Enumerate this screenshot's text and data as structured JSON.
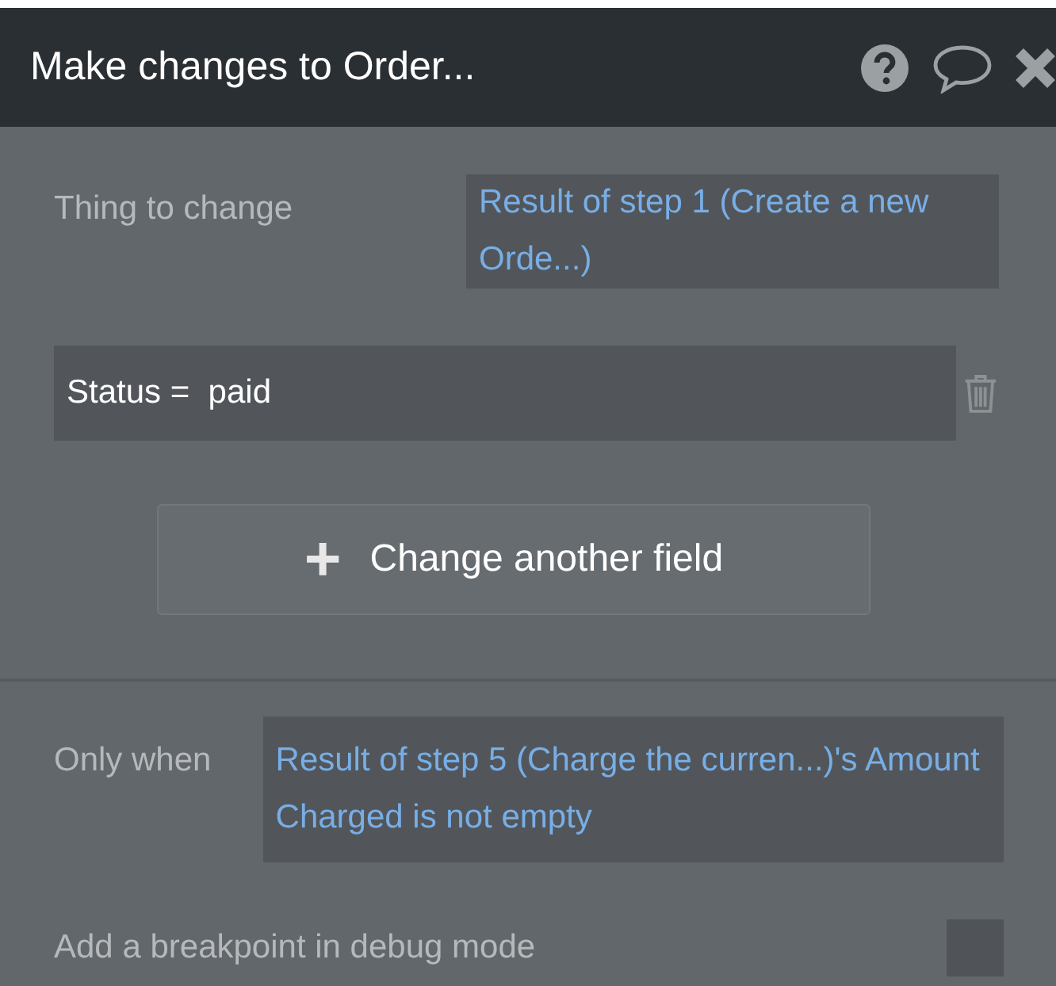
{
  "window": {
    "title": "Make changes to Order..."
  },
  "thing_to_change": {
    "label": "Thing to change",
    "value": "Result of step 1 (Create a new Orde...)"
  },
  "fields": [
    {
      "text": "Status =  paid"
    }
  ],
  "add_field_button": {
    "icon": "+",
    "label": "Change another field"
  },
  "only_when": {
    "label": "Only when",
    "value": "Result of step 5 (Charge the curren...)'s Amount Charged is not empty"
  },
  "breakpoint": {
    "label": "Add a breakpoint in debug mode",
    "checked": false
  }
}
